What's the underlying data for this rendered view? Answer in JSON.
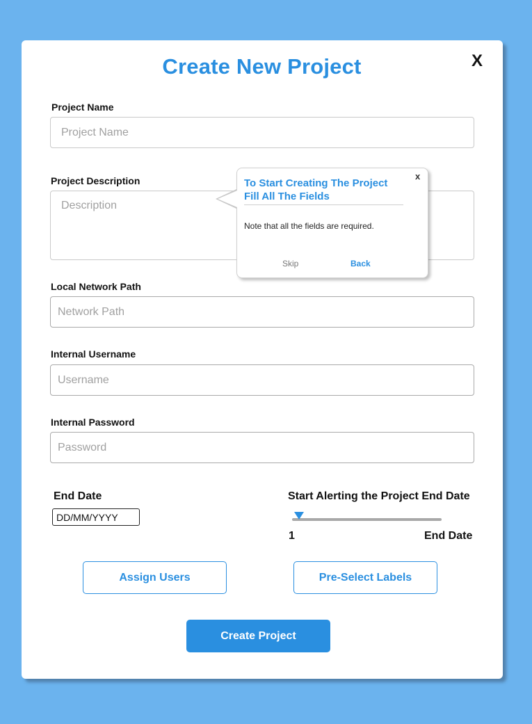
{
  "modal": {
    "title": "Create New Project",
    "close_label": "X"
  },
  "form": {
    "project_name": {
      "label": "Project Name",
      "placeholder": "Project Name",
      "value": ""
    },
    "project_description": {
      "label": "Project Description",
      "placeholder": "Description",
      "value": ""
    },
    "network_path": {
      "label": "Local Network Path",
      "placeholder": "Network Path",
      "value": ""
    },
    "username": {
      "label": "Internal Username",
      "placeholder": "Username",
      "value": ""
    },
    "password": {
      "label": "Internal Password",
      "placeholder": "Password",
      "value": ""
    },
    "end_date": {
      "label": "End Date",
      "placeholder": "DD/MM/YYYY"
    },
    "alert_slider": {
      "label": "Start Alerting the Project End Date",
      "min_label": "1",
      "max_label": "End Date",
      "value_fraction": 0.0
    }
  },
  "buttons": {
    "assign_users": "Assign Users",
    "preselect_labels": "Pre-Select Labels",
    "create_project": "Create Project"
  },
  "tooltip": {
    "title": "To Start Creating The Project Fill All The Fields",
    "note": "Note that all the fields are required.",
    "close_label": "x",
    "skip_label": "Skip",
    "back_label": "Back"
  },
  "colors": {
    "accent": "#2a8fe0",
    "background": "#6bb3ee"
  }
}
